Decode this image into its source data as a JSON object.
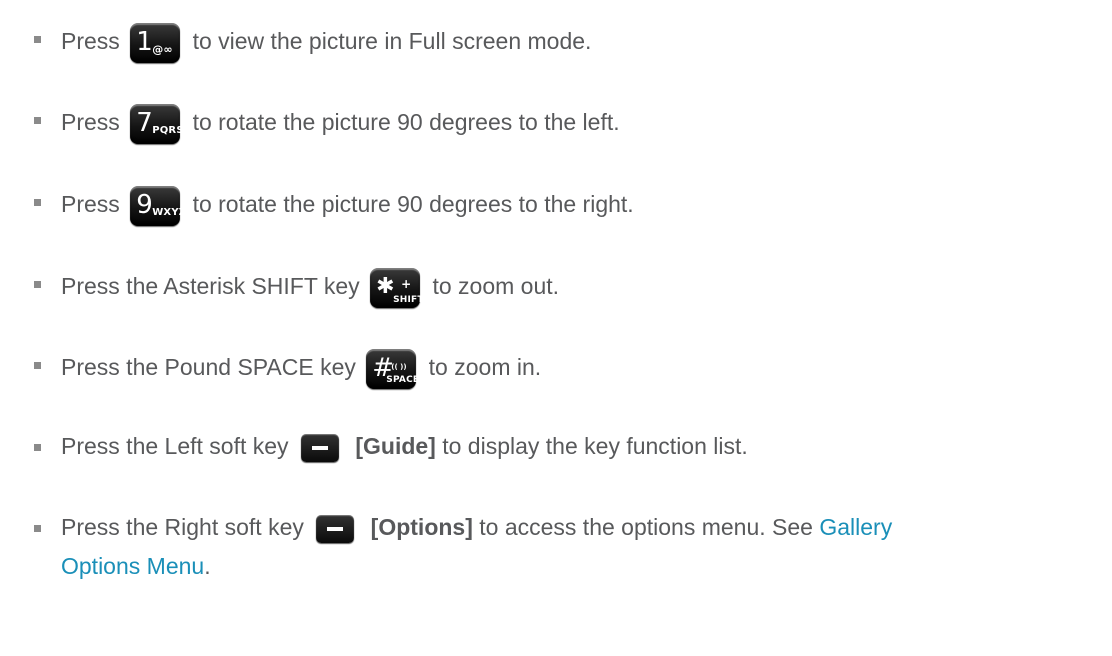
{
  "items": [
    {
      "pre": "Press",
      "key_main": "1",
      "key_sub": "@∞",
      "post": "to view the picture in Full screen mode."
    },
    {
      "pre": "Press",
      "key_main": "7",
      "key_sub": "PQRS",
      "post": "to rotate the picture 90 degrees to the left."
    },
    {
      "pre": "Press",
      "key_main": "9",
      "key_sub": "WXYZ",
      "post": "to rotate the picture 90 degrees to the right."
    },
    {
      "pre": "Press the Asterisk SHIFT key",
      "key_main": "✱",
      "key_sup": "+",
      "key_sub": "SHIFT",
      "post": "to zoom out."
    },
    {
      "pre": "Press the Pound SPACE key",
      "key_main": "#",
      "key_sup": "(( ))",
      "key_sub": "SPACE",
      "post": "to zoom in."
    },
    {
      "pre": "Press the Left soft key",
      "bold": "[Guide]",
      "post": "to display the key function list."
    },
    {
      "pre": "Press the Right soft key",
      "bold": "[Options]",
      "post": "to access the options menu. See",
      "link1": "Gallery",
      "link2": "Options Menu",
      "after_link": "."
    }
  ],
  "colors": {
    "text": "#58595b",
    "link": "#1a8fb8",
    "bullet": "#8a8a8a"
  },
  "icons": {
    "key": "phone-keypad-key-icon",
    "softkey": "soft-key-icon"
  }
}
